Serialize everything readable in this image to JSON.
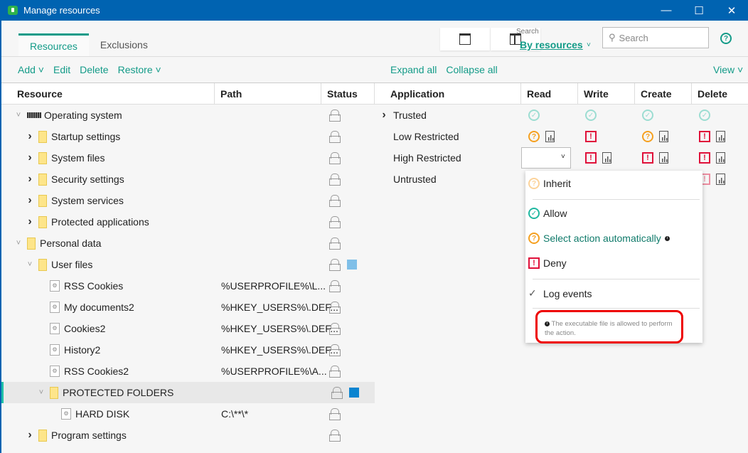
{
  "window": {
    "title": "Manage resources",
    "minimize": "—",
    "maximize": "☐",
    "close": "✕"
  },
  "tabs": [
    {
      "label": "Resources",
      "active": true
    },
    {
      "label": "Exclusions",
      "active": false
    }
  ],
  "search": {
    "label": "Search",
    "mode": "By resources",
    "placeholder": "Search"
  },
  "help": "?",
  "toolbar_left": [
    "Add ˅",
    "Edit",
    "Delete",
    "Restore ˅"
  ],
  "toolbar_right": {
    "expand": "Expand all",
    "collapse": "Collapse all",
    "view": "View ˅"
  },
  "columns_left": [
    "Resource",
    "Path",
    "Status"
  ],
  "columns_right": [
    "Application",
    "Read",
    "Write",
    "Create",
    "Delete"
  ],
  "resources": [
    {
      "name": "Operating system",
      "level": 0,
      "toggle": "open",
      "icon": "chip",
      "path": ""
    },
    {
      "name": "Startup settings",
      "level": 1,
      "toggle": "closed",
      "icon": "folder",
      "path": ""
    },
    {
      "name": "System files",
      "level": 1,
      "toggle": "closed",
      "icon": "folder",
      "path": ""
    },
    {
      "name": "Security settings",
      "level": 1,
      "toggle": "closed",
      "icon": "folder",
      "path": ""
    },
    {
      "name": "System services",
      "level": 1,
      "toggle": "closed",
      "icon": "folder",
      "path": ""
    },
    {
      "name": "Protected applications",
      "level": 1,
      "toggle": "closed",
      "icon": "folder",
      "path": ""
    },
    {
      "name": "Personal data",
      "level": 0,
      "toggle": "open",
      "icon": "folder",
      "path": ""
    },
    {
      "name": "User files",
      "level": 1,
      "toggle": "open",
      "icon": "folder",
      "path": "",
      "color": "#7fbfe8"
    },
    {
      "name": "RSS Cookies",
      "level": 2,
      "toggle": "none",
      "icon": "file",
      "path": "%USERPROFILE%\\L..."
    },
    {
      "name": "My documents2",
      "level": 2,
      "toggle": "none",
      "icon": "file",
      "path": "%HKEY_USERS%\\.DEF..."
    },
    {
      "name": "Cookies2",
      "level": 2,
      "toggle": "none",
      "icon": "file",
      "path": "%HKEY_USERS%\\.DEF..."
    },
    {
      "name": "History2",
      "level": 2,
      "toggle": "none",
      "icon": "file",
      "path": "%HKEY_USERS%\\.DEF..."
    },
    {
      "name": "RSS Cookies2",
      "level": 2,
      "toggle": "none",
      "icon": "file",
      "path": "%USERPROFILE%\\A..."
    },
    {
      "name": "PROTECTED FOLDERS",
      "level": 2,
      "toggle": "open",
      "icon": "folder",
      "path": "",
      "color": "#0a84d0",
      "selected": true
    },
    {
      "name": "HARD DISK",
      "level": 3,
      "toggle": "none",
      "icon": "file",
      "path": "C:\\**\\*"
    },
    {
      "name": "Program settings",
      "level": 1,
      "toggle": "closed",
      "icon": "folder",
      "path": ""
    }
  ],
  "applications": [
    {
      "name": "Trusted",
      "toggle": true,
      "rights": [
        [
          "allow-light",
          false
        ],
        [
          "allow-light",
          false
        ],
        [
          "allow-light",
          false
        ],
        [
          "allow-light",
          false
        ]
      ]
    },
    {
      "name": "Low Restricted",
      "rights": [
        [
          "ask",
          true
        ],
        [
          "deny",
          false
        ],
        [
          "ask",
          true
        ],
        [
          "deny",
          true
        ]
      ]
    },
    {
      "name": "High Restricted",
      "rights": [
        [
          "ask",
          true
        ],
        [
          "deny",
          true
        ],
        [
          "deny",
          true
        ],
        [
          "deny",
          true
        ]
      ]
    },
    {
      "name": "Untrusted",
      "rights": [
        null,
        null,
        null,
        [
          "deny-light",
          true
        ]
      ]
    }
  ],
  "menu": {
    "inherit": "Inherit",
    "allow": "Allow",
    "auto": "Select action automatically",
    "deny": "Deny",
    "log": "Log events",
    "note": "The executable file is allowed to perform the action."
  }
}
